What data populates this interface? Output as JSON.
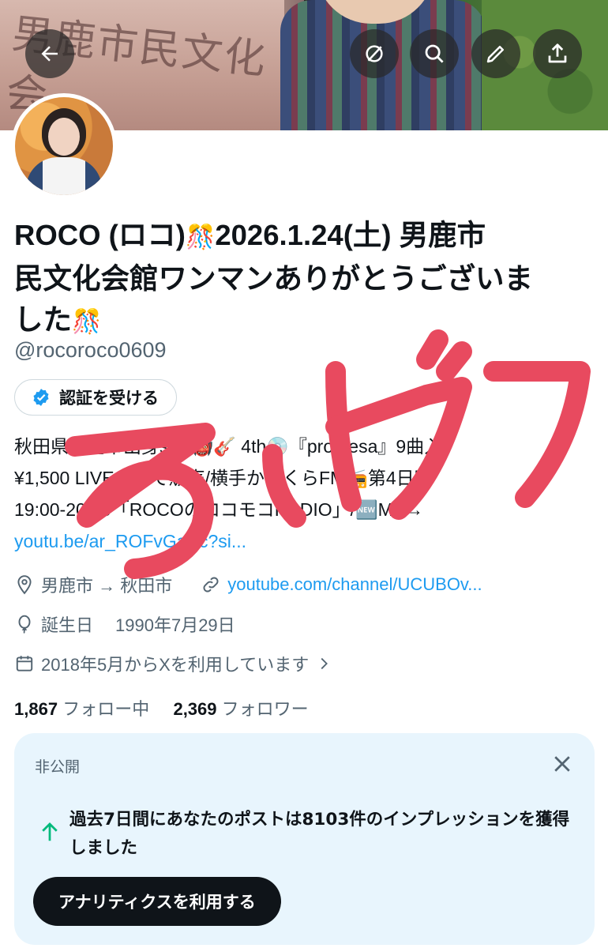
{
  "banner": {
    "stone_text": "男鹿市民文化会"
  },
  "header": {
    "back_icon": "arrow-left-icon",
    "grok_icon": "slash-circle-icon",
    "search_icon": "search-icon",
    "edit_icon": "pencil-icon",
    "share_icon": "share-icon"
  },
  "profile": {
    "name_line1": "ROCO (ロコ)",
    "name_line1b": "2026.1.24(土) 男鹿市",
    "name_line2": "民文化会館ワンマンありがとうございま",
    "name_line3": "した",
    "handle": "@rocoroco0609",
    "verify_label": "認証を受ける",
    "bio_line1": "秋田県男鹿市出身ssw👹🎸 4th💿『promesa』9曲入",
    "bio_line2": "¥1,500 LIVE会場で販売/横手かまくらFM📻第4日曜",
    "bio_line3": "19:00-20:00「ROCOのロコモコRADIO」/🆕MV→",
    "bio_link": "youtu.be/ar_ROFvGaBc?si...",
    "location": "男鹿市 → 秋田市",
    "website": "youtube.com/channel/UCUBOv...",
    "birthday_label": "誕生日",
    "birthday": "1990年7月29日",
    "joined": "2018年5月からXを利用しています",
    "following_count": "1,867",
    "following_label": "フォロー中",
    "followers_count": "2,369",
    "followers_label": "フォロワー"
  },
  "analytics_card": {
    "private_label": "非公開",
    "message": "過去7日間にあなたのポストは8103件のインプレッションを獲得しました",
    "cta_label": "アナリティクスを利用する"
  },
  "overlay": {
    "handwritten_text": "ろっかフ",
    "color": "#e84a5f"
  },
  "colors": {
    "link": "#1d9bf0",
    "secondary_text": "#536471",
    "card_bg": "#e8f5fd",
    "verified": "#1d9bf0"
  }
}
